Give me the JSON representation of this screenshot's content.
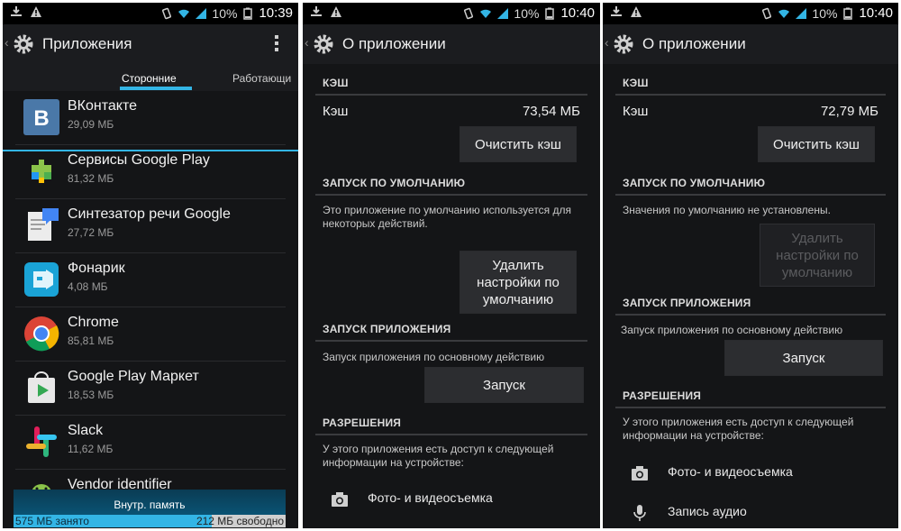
{
  "colors": {
    "accent": "#33b5e5",
    "background": "#141517"
  },
  "screen1": {
    "status": {
      "battery": "10%",
      "time": "10:39"
    },
    "title": "Приложения",
    "tabs": [
      "Сторонние",
      "Работающи"
    ],
    "apps": [
      {
        "name": "ВКонтакте",
        "size": "29,09 МБ",
        "icon": "vk-icon"
      },
      {
        "name": "Сервисы Google Play",
        "size": "81,32 МБ",
        "icon": "google-play-services-icon"
      },
      {
        "name": "Синтезатор речи Google",
        "size": "27,72 МБ",
        "icon": "google-tts-icon"
      },
      {
        "name": "Фонарик",
        "size": "4,08 МБ",
        "icon": "flashlight-icon"
      },
      {
        "name": "Chrome",
        "size": "85,81 МБ",
        "icon": "chrome-icon"
      },
      {
        "name": "Google Play Маркет",
        "size": "18,53 МБ",
        "icon": "play-store-icon"
      },
      {
        "name": "Slack",
        "size": "11,62 МБ",
        "icon": "slack-icon"
      },
      {
        "name": "Vendor identifier",
        "size": "",
        "icon": "android-icon"
      }
    ],
    "storage": {
      "title": "Внутр. память",
      "used": "575 МБ занято",
      "free": "212 МБ свободно",
      "used_fraction": 0.73
    }
  },
  "screen2": {
    "status": {
      "battery": "10%",
      "time": "10:40"
    },
    "title": "О приложении",
    "cache_header": "КЭШ",
    "cache_label": "Кэш",
    "cache_value": "73,54 МБ",
    "clear_cache": "Очистить кэш",
    "launch_default_header": "ЗАПУСК ПО УМОЛЧАНИЮ",
    "launch_default_text": "Это приложение по умолчанию используется для некоторых действий.",
    "clear_defaults": "Удалить настройки по умолчанию",
    "launch_app_header": "ЗАПУСК ПРИЛОЖЕНИЯ",
    "launch_app_text": "Запуск приложения по основному действию",
    "launch_button": "Запуск",
    "permissions_header": "РАЗРЕШЕНИЯ",
    "permissions_text": "У этого приложения есть доступ к следующей информации на устройстве:",
    "permissions": [
      "Фото- и видеосъемка"
    ]
  },
  "screen3": {
    "status": {
      "battery": "10%",
      "time": "10:40"
    },
    "title": "О приложении",
    "cache_header": "КЭШ",
    "cache_label": "Кэш",
    "cache_value": "72,79 МБ",
    "clear_cache": "Очистить кэш",
    "launch_default_header": "ЗАПУСК ПО УМОЛЧАНИЮ",
    "launch_default_text": "Значения по умолчанию не установлены.",
    "clear_defaults": "Удалить настройки по умолчанию",
    "launch_app_header": "ЗАПУСК ПРИЛОЖЕНИЯ",
    "launch_app_text": "Запуск приложения по основному действию",
    "launch_button": "Запуск",
    "permissions_header": "РАЗРЕШЕНИЯ",
    "permissions_text": "У этого приложения есть доступ к следующей информации на устройстве:",
    "permissions": [
      "Фото- и видеосъемка",
      "Запись аудио"
    ]
  }
}
